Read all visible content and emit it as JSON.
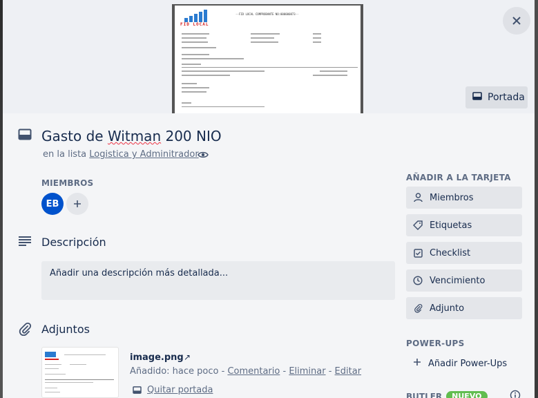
{
  "card": {
    "title_prefix": "Gasto de ",
    "title_word": "Witman",
    "title_suffix": " 200 NIO",
    "in_list_prefix": "en la lista ",
    "list_name": "Logistica y Adminitrador"
  },
  "cover": {
    "button_label": "Portada",
    "doc_brand": "FID LOCAL",
    "doc_title": "--FID LOCAL COMPROBANTE NO:000000873--"
  },
  "members": {
    "heading": "MIEMBROS",
    "avatar_initials": "EB",
    "avatar_color": "#0052cc"
  },
  "description": {
    "heading": "Descripción",
    "placeholder": "Añadir una descripción más detallada..."
  },
  "attachments": {
    "heading": "Adjuntos",
    "item": {
      "name": "image.png",
      "arrow": "↗",
      "added_prefix": "Añadido: hace poco - ",
      "comment_label": "Comentario",
      "sep1": " - ",
      "delete_label": "Eliminar",
      "sep2": " - ",
      "edit_label": "Editar",
      "remove_cover_label": "Quitar portada"
    }
  },
  "sidebar": {
    "add_heading": "AÑADIR A LA TARJETA",
    "buttons": [
      {
        "label": "Miembros",
        "icon": "person-icon"
      },
      {
        "label": "Etiquetas",
        "icon": "tag-icon"
      },
      {
        "label": "Checklist",
        "icon": "checklist-icon"
      },
      {
        "label": "Vencimiento",
        "icon": "clock-icon"
      },
      {
        "label": "Adjunto",
        "icon": "paperclip-icon"
      }
    ],
    "powerups_heading": "POWER-UPS",
    "add_powerups_label": "Añadir Power-Ups",
    "butler_label": "BUTLER",
    "new_badge": "NUEVO",
    "badge_color": "#61bd4f"
  }
}
